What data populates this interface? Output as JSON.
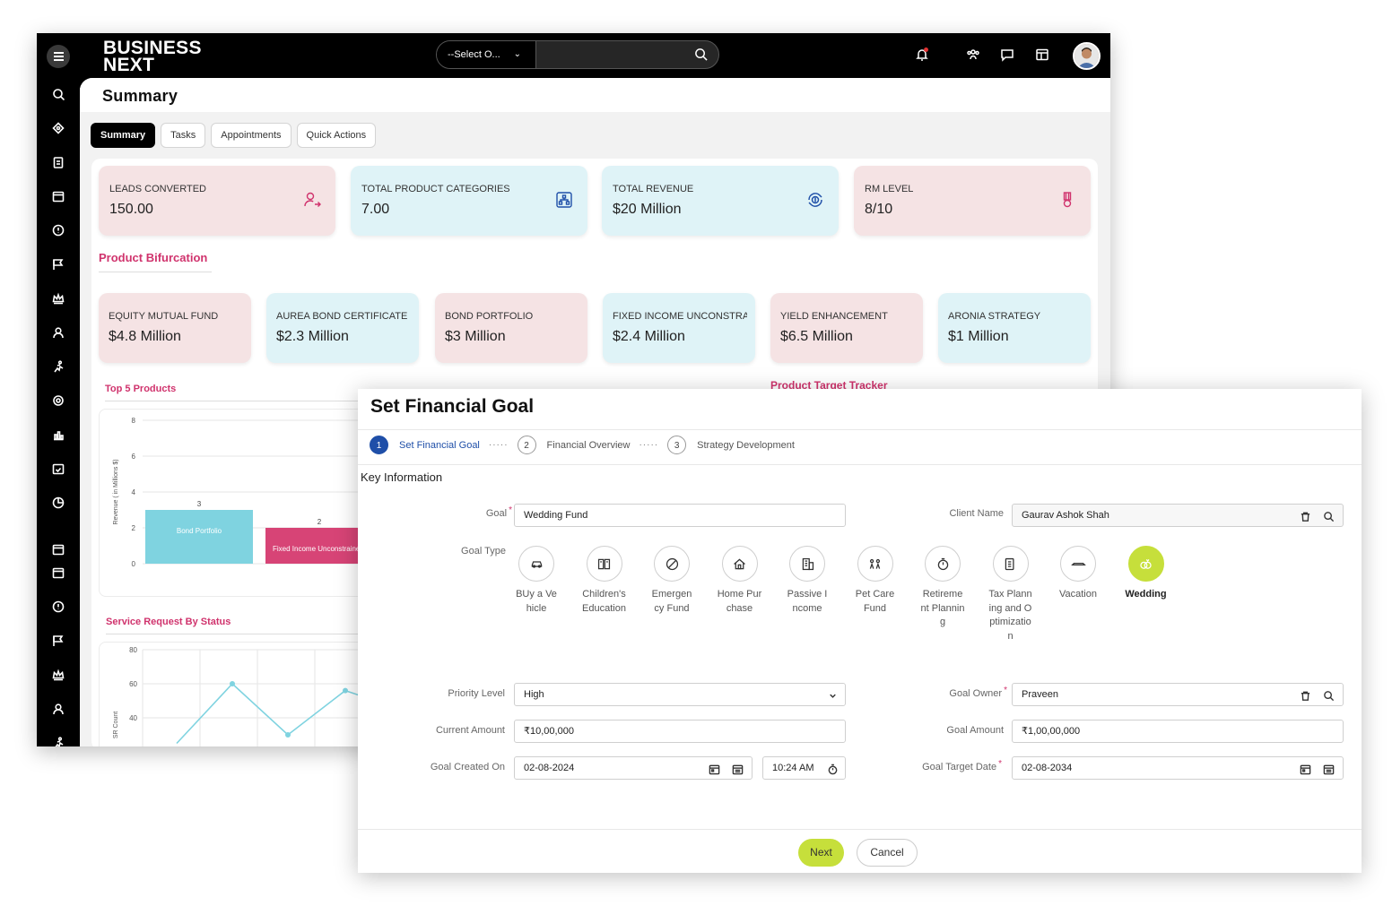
{
  "topbar": {
    "logo_line1": "BUSINESS",
    "logo_line2": "NEXT",
    "search_select": "--Select O...",
    "search_placeholder": ""
  },
  "sidebar": {
    "icons": [
      "search-icon",
      "network-icon",
      "clipboard-icon",
      "calendar-icon",
      "alert-icon",
      "flag-icon",
      "crown-icon",
      "user-icon",
      "run-icon",
      "gear-icon",
      "chart-icon",
      "calendar-check-icon",
      "pie-icon",
      "calendar-icon",
      "calendar-icon",
      "alert-icon",
      "flag-icon",
      "crown-icon",
      "user-icon",
      "run-icon"
    ]
  },
  "summary": {
    "title": "Summary",
    "tabs": [
      "Summary",
      "Tasks",
      "Appointments",
      "Quick Actions"
    ],
    "kpis": [
      {
        "label": "LEADS CONVERTED",
        "value": "150.00",
        "color": "pink",
        "icon": "user-arrow-icon"
      },
      {
        "label": "TOTAL PRODUCT CATEGORIES",
        "value": "7.00",
        "color": "blue",
        "icon": "sitemap-icon"
      },
      {
        "label": "TOTAL REVENUE",
        "value": "$20 Million",
        "color": "blue",
        "icon": "dollar-refresh-icon"
      },
      {
        "label": "RM LEVEL",
        "value": "8/10",
        "color": "pink",
        "icon": "medal-icon"
      }
    ],
    "product_bifurcation_title": "Product Bifurcation",
    "products": [
      {
        "label": "EQUITY MUTUAL FUND",
        "value": "$4.8 Million",
        "color": "pink"
      },
      {
        "label": "AUREA BOND CERTIFICATE",
        "value": "$2.3 Million",
        "color": "blue"
      },
      {
        "label": "BOND PORTFOLIO",
        "value": "$3 Million",
        "color": "pink"
      },
      {
        "label": "FIXED INCOME UNCONSTRAINED",
        "value": "$2.4 Million",
        "color": "blue"
      },
      {
        "label": "YIELD ENHANCEMENT",
        "value": "$6.5 Million",
        "color": "pink"
      },
      {
        "label": "ARONIA STRATEGY",
        "value": "$1 Million",
        "color": "blue"
      }
    ],
    "top5_title": "Top 5 Products",
    "target_tracker_title": "Product Target Tracker",
    "service_title": "Service Request By Status"
  },
  "chart_data": [
    {
      "type": "bar",
      "title": "Top 5 Products",
      "ylabel": "Revenue ( in Millions $)",
      "ylim": [
        0,
        8
      ],
      "yticks": [
        "0",
        "2",
        "4",
        "6",
        "8"
      ],
      "categories": [
        "Bond Portfolio",
        "Fixed Income Unconstrained"
      ],
      "values": [
        3,
        2
      ],
      "colors": [
        "#7fd3e0",
        "#d74476"
      ]
    },
    {
      "type": "line",
      "title": "Service Request By Status",
      "ylabel": "SR Count",
      "yticks": [
        "40",
        "60",
        "80"
      ],
      "ylim": [
        35,
        80
      ],
      "series": [
        {
          "values": [
            25,
            60,
            30,
            56,
            45
          ]
        }
      ],
      "color": "#7fd3e0"
    }
  ],
  "modal": {
    "title": "Set Financial Goal",
    "steps": [
      {
        "num": "1",
        "label": "Set Financial Goal"
      },
      {
        "num": "2",
        "label": "Financial Overview"
      },
      {
        "num": "3",
        "label": "Strategy Development"
      }
    ],
    "step_dots": "·····",
    "section": "Key Information",
    "goal_label": "Goal",
    "goal_value": "Wedding Fund",
    "client_label": "Client Name",
    "client_value": "Gaurav Ashok Shah",
    "goal_type_label": "Goal Type",
    "goal_types": [
      {
        "label": "BUy a Vehicle",
        "icon": "car-icon"
      },
      {
        "label": "Children's Education",
        "icon": "book-icon"
      },
      {
        "label": "Emergency Fund",
        "icon": "ban-icon"
      },
      {
        "label": "Home Purchase",
        "icon": "home-icon"
      },
      {
        "label": "Passive Income",
        "icon": "building-icon"
      },
      {
        "label": "Pet Care Fund",
        "icon": "paw-icon"
      },
      {
        "label": "Retirement Planning",
        "icon": "clock-icon"
      },
      {
        "label": "Tax Planning and Optimization",
        "icon": "document-icon"
      },
      {
        "label": "Vacation",
        "icon": "plane-icon"
      },
      {
        "label": "Wedding",
        "icon": "rings-icon"
      }
    ],
    "selected_goal_type": "Wedding",
    "priority_label": "Priority Level",
    "priority_value": "High",
    "owner_label": "Goal Owner",
    "owner_value": "Praveen",
    "current_amount_label": "Current Amount",
    "current_amount_value": "₹10,00,000",
    "goal_amount_label": "Goal Amount",
    "goal_amount_value": "₹1,00,00,000",
    "created_label": "Goal Created On",
    "created_date": "02-08-2024",
    "created_time": "10:24 AM",
    "target_label": "Goal Target Date",
    "target_date": "02-08-2034",
    "next_label": "Next",
    "cancel_label": "Cancel"
  },
  "colors": {
    "accent_green": "#c6df3b",
    "brand_pink": "#d0336d",
    "step_blue": "#1f4fa8",
    "kpi_pink": "#f5e3e4",
    "kpi_blue": "#dff3f7"
  }
}
